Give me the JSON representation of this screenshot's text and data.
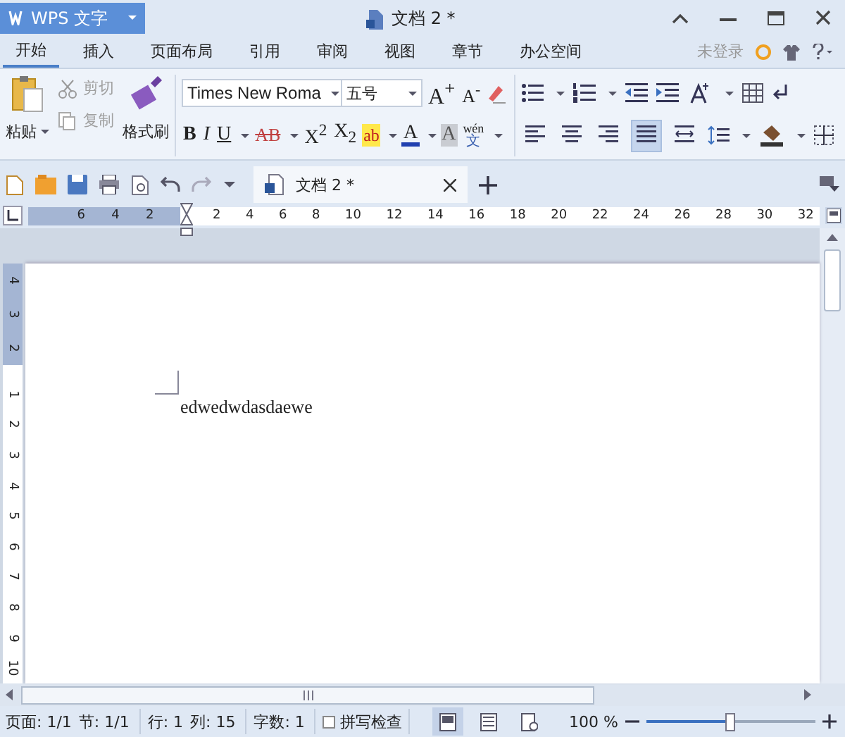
{
  "app_menu": {
    "label": "WPS 文字"
  },
  "window": {
    "title": "文档 2 *"
  },
  "ribbon_tabs": [
    {
      "label": "开始",
      "selected": true
    },
    {
      "label": "插入",
      "selected": false
    },
    {
      "label": "页面布局",
      "selected": false
    },
    {
      "label": "引用",
      "selected": false
    },
    {
      "label": "审阅",
      "selected": false
    },
    {
      "label": "视图",
      "selected": false
    },
    {
      "label": "章节",
      "selected": false
    },
    {
      "label": "办公空间",
      "selected": false
    }
  ],
  "account": {
    "label": "未登录"
  },
  "clipboard": {
    "paste": {
      "label": "粘贴"
    },
    "cut": {
      "label": "剪切",
      "disabled": true
    },
    "copy": {
      "label": "复制",
      "disabled": true
    },
    "format_painter": {
      "label": "格式刷"
    }
  },
  "font": {
    "name": "Times New Roma",
    "size": "五号",
    "grow": "A$^{+}$",
    "shrink": "A$^{-}$"
  },
  "format_buttons": [
    {
      "kind": "bold",
      "label": "B",
      "dropdown": false
    },
    {
      "kind": "italic",
      "label": "I",
      "dropdown": false
    },
    {
      "kind": "underline",
      "label": "U",
      "dropdown": true
    },
    {
      "kind": "strike",
      "label": "AB",
      "dropdown": true
    },
    {
      "kind": "superscript",
      "label": "X$^{2}$",
      "dropdown": false
    },
    {
      "kind": "subscript",
      "label": "X$_{2}$",
      "dropdown": false
    },
    {
      "kind": "highlight",
      "label": "ab",
      "dropdown": true
    },
    {
      "kind": "color",
      "label": "A",
      "dropdown": true
    },
    {
      "kind": "shading",
      "label": "A",
      "dropdown": false
    },
    {
      "kind": "phonetic",
      "label": "wén",
      "sub": "文",
      "dropdown": true
    }
  ],
  "alignment": [
    {
      "kind": "left",
      "selected": false
    },
    {
      "kind": "center",
      "selected": false
    },
    {
      "kind": "right",
      "selected": false
    },
    {
      "kind": "justify",
      "selected": true
    },
    {
      "kind": "distributed",
      "selected": false
    }
  ],
  "document_tab": {
    "label": "文档 2 *"
  },
  "ruler": {
    "left_marks": [
      "6",
      "4",
      "2"
    ],
    "right_marks": [
      "2",
      "4",
      "6",
      "8",
      "10",
      "12",
      "14",
      "16",
      "18",
      "20",
      "22",
      "24",
      "26",
      "28",
      "30",
      "32"
    ]
  },
  "vertical_ruler": {
    "top_marks": [
      "4",
      "3",
      "2"
    ],
    "marks": [
      "1",
      "2",
      "3",
      "4",
      "5",
      "6",
      "7",
      "8",
      "9",
      "10"
    ]
  },
  "document": {
    "text": "edwedwdasdaewe"
  },
  "status_bar": {
    "fields": [
      "页面: 1/1",
      "节: 1/1",
      "行: 1",
      "列: 15",
      "字数: 1"
    ],
    "spell_check": {
      "label": "拼写检查",
      "checked": false
    }
  },
  "view_buttons": [
    {
      "kind": "page",
      "selected": true
    },
    {
      "kind": "outline",
      "selected": false
    },
    {
      "kind": "web",
      "selected": false
    }
  ],
  "zoom": {
    "label": "100 %",
    "level": 0.5
  }
}
